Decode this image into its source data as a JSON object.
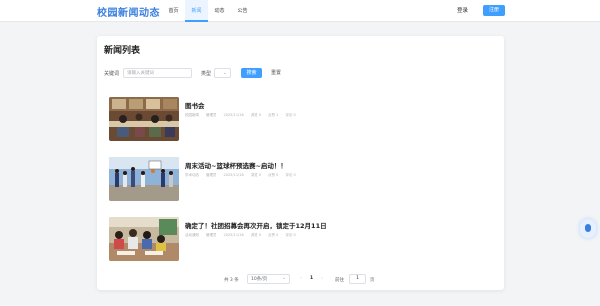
{
  "header": {
    "logo": "校园新闻动态",
    "nav": [
      {
        "label": "首页",
        "active": false
      },
      {
        "label": "新闻",
        "active": true
      },
      {
        "label": "动态",
        "active": false
      },
      {
        "label": "公告",
        "active": false
      }
    ],
    "login": "登录",
    "register": "注册"
  },
  "page": {
    "title": "新闻列表",
    "filter": {
      "keyword_label": "关键词",
      "keyword_placeholder": "请输入关键词",
      "type_label": "类型",
      "search": "搜索",
      "reset": "重置"
    },
    "news": [
      {
        "title": "图书会",
        "category": "校园新闻",
        "author": "管理员",
        "date": "2025/11/16",
        "views": "浏览 0",
        "likes": "点赞 1",
        "comments": "评论 0",
        "image": "library"
      },
      {
        "title": "周末活动~篮球杯预选赛~启动！！",
        "category": "学术动态",
        "author": "管理员",
        "date": "2025/11/16",
        "views": "浏览 0",
        "likes": "点赞 0",
        "comments": "评论 0",
        "image": "basketball"
      },
      {
        "title": "确定了！社团招募会再次开启，锁定于12月11日",
        "category": "活动通知",
        "author": "管理员",
        "date": "2025/11/16",
        "views": "浏览 0",
        "likes": "点赞 0",
        "comments": "评论 0",
        "image": "classroom"
      }
    ],
    "pagination": {
      "total": "共 3 条",
      "page_size": "10条/页",
      "prev": "‹",
      "current": "1",
      "next": "›",
      "goto_label": "前往",
      "goto_value": "1",
      "page_unit": "页"
    }
  },
  "colors": {
    "accent": "#409eff",
    "logo": "#3a7fe0"
  }
}
